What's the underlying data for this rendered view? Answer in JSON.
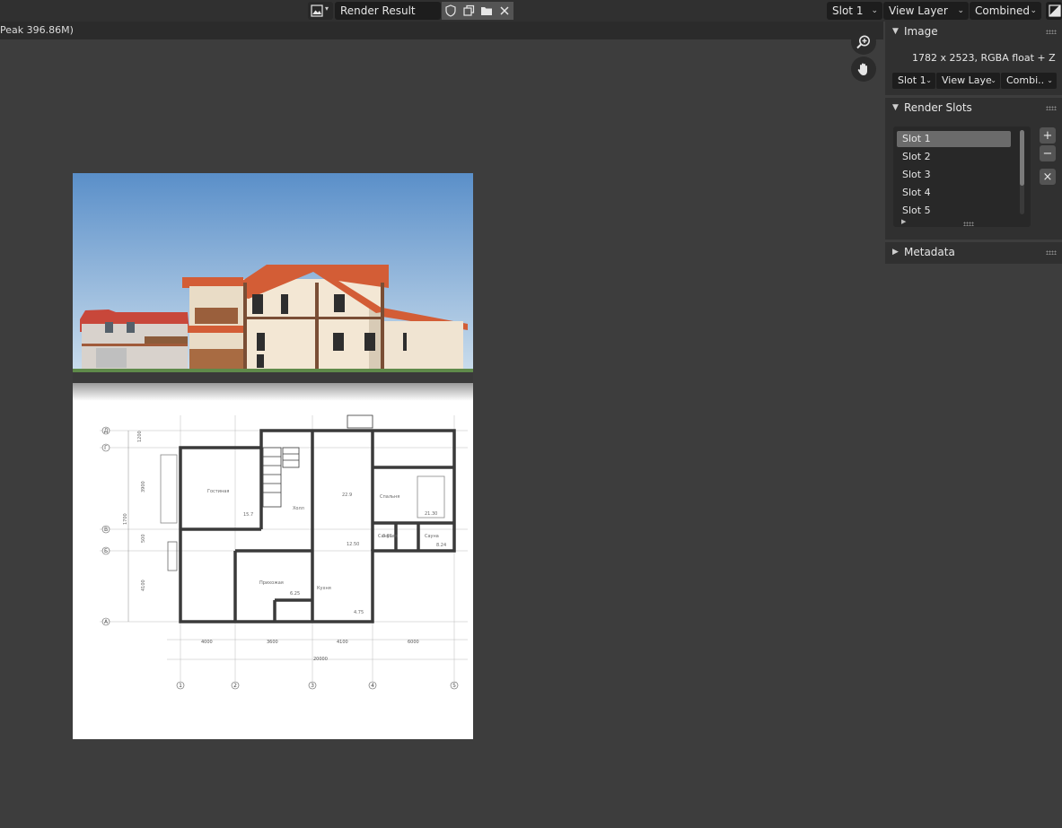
{
  "header": {
    "image_name": "Render Result",
    "slot": "Slot 1",
    "view_layer": "View Layer",
    "pass": "Combined"
  },
  "status": {
    "memory_text": "Peak 396.86M)"
  },
  "sidebar": {
    "image_panel": {
      "title": "Image",
      "info": "1782 x 2523,  RGBA float + Z",
      "slot": "Slot 1",
      "view_layer": "View Laye",
      "pass": "Combi.."
    },
    "render_slots_panel": {
      "title": "Render Slots",
      "slots": [
        "Slot 1",
        "Slot 2",
        "Slot 3",
        "Slot 4",
        "Slot 5"
      ],
      "active_slot": "Slot 1",
      "add_label": "+",
      "remove_label": "−",
      "clear_label": "×"
    },
    "metadata_panel": {
      "title": "Metadata"
    }
  },
  "drawing": {
    "grid_letters": [
      "Д",
      "Г",
      "В",
      "Б",
      "А"
    ],
    "grid_numbers": [
      "1",
      "2",
      "3",
      "4",
      "5"
    ],
    "dimensions": [
      "4000",
      "3600",
      "4100",
      "6000",
      "20000"
    ],
    "left_dims": [
      "1200",
      "3900",
      "1700",
      "500",
      "4100"
    ],
    "room_labels": [
      "Гостиная",
      "Спальня",
      "Кухня",
      "Прихожая",
      "Холл",
      "Санузел",
      "Сауна"
    ],
    "area_labels": [
      "21.30",
      "12.50",
      "6.25",
      "4.75",
      "15.7",
      "3.81",
      "22.9",
      "8.24"
    ]
  },
  "colors": {
    "accent_active_slot": "#6b6b6b",
    "viewer_bg": "#3d3d3d",
    "header_bg": "#303030"
  }
}
